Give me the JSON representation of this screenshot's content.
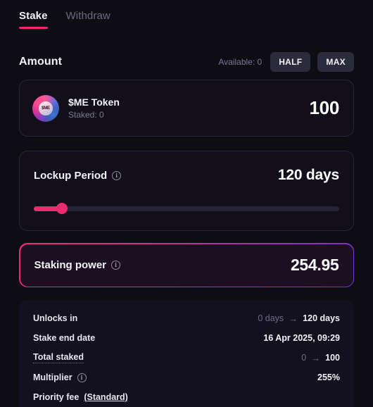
{
  "tabs": [
    {
      "label": "Stake",
      "active": true
    },
    {
      "label": "Withdraw",
      "active": false
    }
  ],
  "amount_section": {
    "title": "Amount",
    "available_label": "Available: 0",
    "half_label": "HALF",
    "max_label": "MAX"
  },
  "token": {
    "icon_name": "me-token-logo",
    "logo_text": "$ME",
    "name": "$ME Token",
    "staked_label": "Staked: 0",
    "amount": "100"
  },
  "lockup": {
    "label": "Lockup Period",
    "info_icon": "info-icon",
    "value": "120 days",
    "slider_percent": 9.2
  },
  "staking_power": {
    "label": "Staking power",
    "info_icon": "info-icon",
    "value": "254.95"
  },
  "details": [
    {
      "key": "Unlocks in",
      "from": "0 days",
      "arrow": "→",
      "to": "120 days"
    },
    {
      "key": "Stake end date",
      "to": "16 Apr 2025, 09:29"
    },
    {
      "key": "Total staked",
      "from": "0",
      "arrow": "→",
      "to": "100"
    },
    {
      "key": "Multiplier",
      "to": "255%"
    },
    {
      "key": "Priority fee",
      "link": "(Standard)"
    }
  ],
  "colors": {
    "accent_pink": "#ec2b6e",
    "accent_purple": "#7b2fd4",
    "page_bg": "#0e0d14",
    "card_bg": "#120f1a",
    "panel_bg": "#131120",
    "power_bg": "#1b0f21",
    "muted_text": "#6e6b80"
  }
}
